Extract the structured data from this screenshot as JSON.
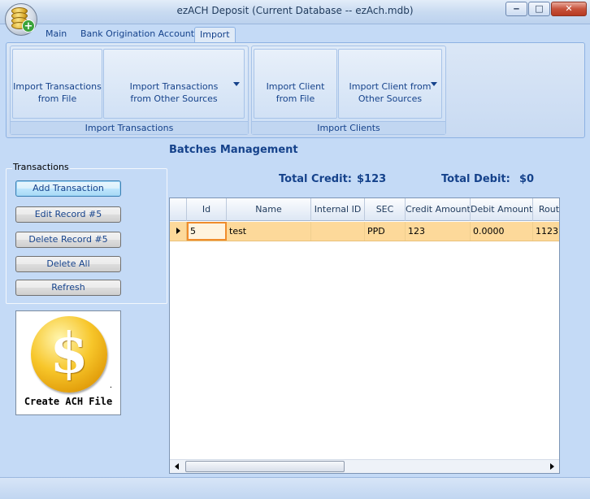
{
  "window": {
    "title": "ezACH Deposit (Current Database -- ezAch.mdb)",
    "minimize": "‒",
    "maximize": "□",
    "close": "✕"
  },
  "app_orb": {
    "icon": "coins-add-icon",
    "plus": "+"
  },
  "tabs": [
    "Main",
    "Bank Origination Account",
    "Import"
  ],
  "active_tab": "Import",
  "ribbon": {
    "groups": [
      {
        "label": "Import Transactions",
        "buttons": [
          {
            "line1": "Import Transactions",
            "line2": "from File",
            "has_dropdown": false
          },
          {
            "line1": "Import Transactions",
            "line2": "from Other Sources",
            "has_dropdown": true
          }
        ]
      },
      {
        "label": "Import Clients",
        "buttons": [
          {
            "line1": "Import Client",
            "line2": "from File",
            "has_dropdown": false
          },
          {
            "line1": "Import Client from",
            "line2": "Other Sources",
            "has_dropdown": true
          }
        ]
      }
    ]
  },
  "transactions_panel": {
    "label": "Transactions",
    "buttons": {
      "add": "Add Transaction",
      "edit": "Edit Record #5",
      "delete": "Delete Record #5",
      "delete_all": "Delete All",
      "refresh": "Refresh"
    }
  },
  "create_ach": {
    "label": "Create ACH File",
    "symbol": "$",
    "dot": "."
  },
  "batches": {
    "title": "Batches Management",
    "total_credit_label": "Total Credit:",
    "total_credit_value": "$123",
    "total_debit_label": "Total Debit:",
    "total_debit_value": "$0"
  },
  "grid": {
    "columns": [
      "Id",
      "Name",
      "Internal ID",
      "SEC",
      "Credit Amount",
      "Debit Amount",
      "Rout"
    ],
    "rows": [
      {
        "id": "5",
        "name": "test",
        "internal_id": "",
        "sec": "PPD",
        "credit": "123",
        "debit": "0.0000",
        "rout": "1123"
      }
    ]
  },
  "colors": {
    "accent_text": "#15428b",
    "selected_row": "#fdd99a",
    "selected_cell_border": "#f08c2c"
  }
}
